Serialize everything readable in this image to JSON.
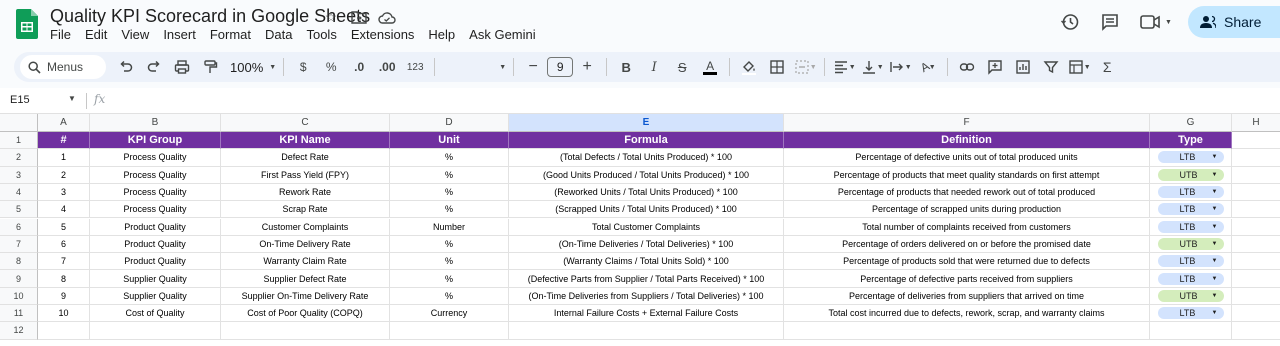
{
  "app": {
    "title": "Quality KPI Scorecard in Google Sheets",
    "menus": [
      "File",
      "Edit",
      "View",
      "Insert",
      "Format",
      "Data",
      "Tools",
      "Extensions",
      "Help",
      "Ask Gemini"
    ],
    "share_label": "Share"
  },
  "toolbar": {
    "search_label": "Menus",
    "zoom": "100%",
    "currency": "$",
    "percent": "%",
    "dec_decrease": ".0",
    "dec_increase": ".00",
    "number_format": "123",
    "font_size": "9"
  },
  "formula_bar": {
    "cell_ref": "E15",
    "fx": "fx",
    "value": ""
  },
  "sheet": {
    "columns": [
      "A",
      "B",
      "C",
      "D",
      "E",
      "F",
      "G",
      "H"
    ],
    "selected_column": "E",
    "header_row": [
      "#",
      "KPI Group",
      "KPI Name",
      "Unit",
      "Formula",
      "Definition",
      "Type"
    ],
    "rows": [
      [
        "1",
        "Process Quality",
        "Defect Rate",
        "%",
        "(Total Defects / Total Units Produced) * 100",
        "Percentage of defective units out of total produced units",
        "LTB"
      ],
      [
        "2",
        "Process Quality",
        "First Pass Yield (FPY)",
        "%",
        "(Good Units Produced / Total Units Produced) * 100",
        "Percentage of products that meet quality standards on first attempt",
        "UTB"
      ],
      [
        "3",
        "Process Quality",
        "Rework Rate",
        "%",
        "(Reworked Units / Total Units Produced) * 100",
        "Percentage of products that needed rework out of total produced",
        "LTB"
      ],
      [
        "4",
        "Process Quality",
        "Scrap Rate",
        "%",
        "(Scrapped Units / Total Units Produced) * 100",
        "Percentage of scrapped units during production",
        "LTB"
      ],
      [
        "5",
        "Product Quality",
        "Customer Complaints",
        "Number",
        "Total Customer Complaints",
        "Total number of complaints received from customers",
        "LTB"
      ],
      [
        "6",
        "Product Quality",
        "On-Time Delivery Rate",
        "%",
        "(On-Time Deliveries / Total Deliveries) * 100",
        "Percentage of orders delivered on or before the promised date",
        "UTB"
      ],
      [
        "7",
        "Product Quality",
        "Warranty Claim Rate",
        "%",
        "(Warranty Claims / Total Units Sold) * 100",
        "Percentage of products sold that were returned due to defects",
        "LTB"
      ],
      [
        "8",
        "Supplier Quality",
        "Supplier Defect Rate",
        "%",
        "(Defective Parts from Supplier / Total Parts Received) * 100",
        "Percentage of defective parts received from suppliers",
        "LTB"
      ],
      [
        "9",
        "Supplier Quality",
        "Supplier On-Time Delivery Rate",
        "%",
        "(On-Time Deliveries from Suppliers / Total Deliveries) * 100",
        "Percentage of deliveries from suppliers that arrived on time",
        "UTB"
      ],
      [
        "10",
        "Cost of Quality",
        "Cost of Poor Quality (COPQ)",
        "Currency",
        "Internal Failure Costs + External Failure Costs",
        "Total cost incurred due to defects, rework, scrap, and warranty claims",
        "LTB"
      ]
    ],
    "row_numbers": [
      "1",
      "2",
      "3",
      "4",
      "5",
      "6",
      "7",
      "8",
      "9",
      "10",
      "11",
      "12"
    ]
  },
  "colors": {
    "header_bg": "#7030a0",
    "ltb_chip": "#d3e3fd",
    "utb_chip": "#d4edbc",
    "selected_col": "#d3e3fd",
    "share_bg": "#c2e7ff"
  }
}
